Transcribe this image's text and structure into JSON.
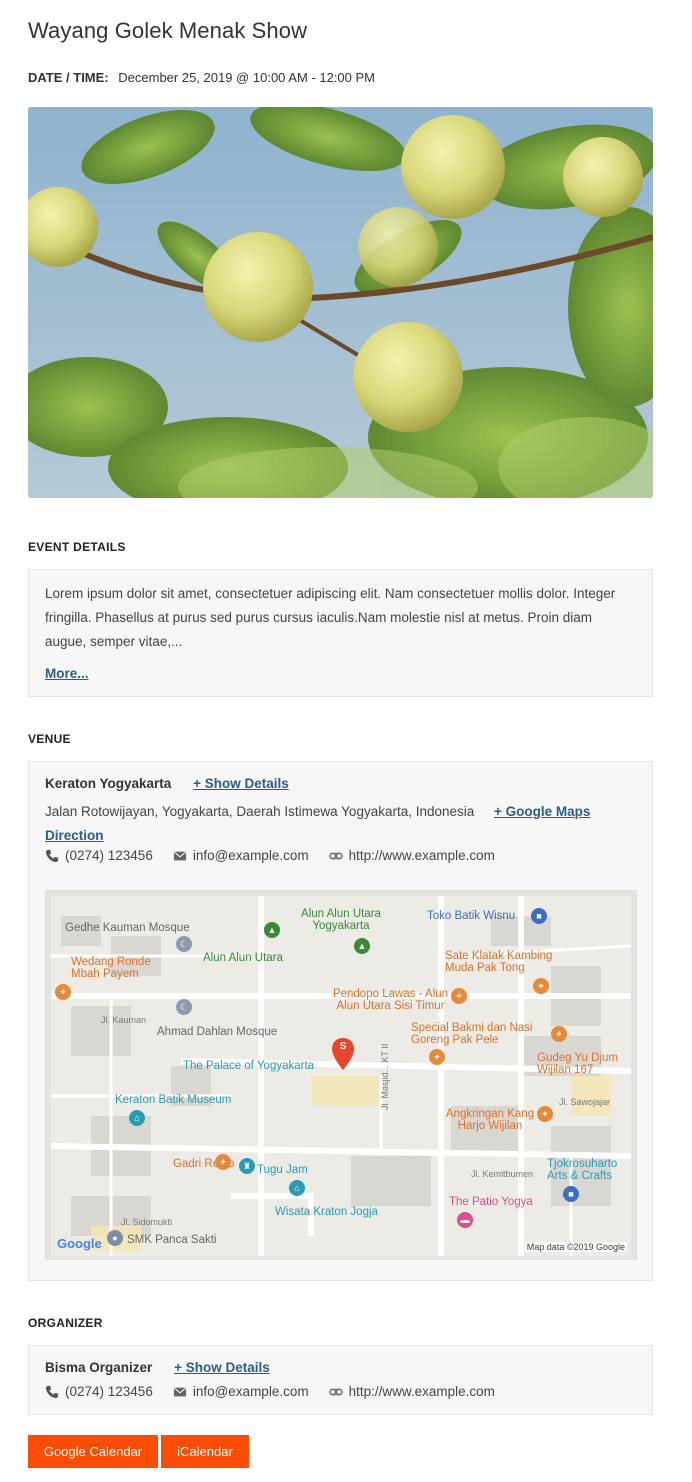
{
  "event": {
    "title": "Wayang Golek Menak Show",
    "datetime_label": "DATE / TIME:",
    "datetime_value": "December 25, 2019 @ 10:00 AM - 12:00 PM"
  },
  "details": {
    "heading": "EVENT DETAILS",
    "text": "Lorem ipsum dolor sit amet, consectetuer adipiscing elit. Nam consectetuer mollis dolor. Integer fringilla. Phasellus at purus sed purus cursus iaculis.Nam molestie nisl at metus. Proin diam augue, semper vitae,...",
    "more_link": "More..."
  },
  "venue": {
    "heading": "VENUE",
    "name": "Keraton Yogyakarta",
    "show_details": "+ Show Details",
    "address": "Jalan Rotowijayan, Yogyakarta, Daerah Istimewa Yogyakarta, Indonesia",
    "maps_link": "+ Google Maps Direction",
    "phone": "(0274) 123456",
    "email": "info@example.com",
    "website": "http://www.example.com"
  },
  "map": {
    "labels": {
      "gedhe": "Gedhe Kauman Mosque",
      "alun_utara_yogya": "Alun Alun Utara Yogyakarta",
      "toko_batik": "Toko Batik Wisnu",
      "alun_utara": "Alun Alun Utara",
      "sate": "Sate Klatak Kambing Muda Pak Tong",
      "wedang": "Wedang Ronde Mbah Payem",
      "pendopo": "Pendopo Lawas - Alun Alun Utara Sisi Timur",
      "kauman_street": "Jl. Kauman",
      "ahmad": "Ahmad Dahlan Mosque",
      "bakmi": "Special Bakmi dan Nasi Goreng Pak Pele",
      "gudeg": "Gudeg Yu Djum Wijilan 167",
      "palace": "The Palace of Yogyakarta",
      "keraton_batik": "Keraton Batik Museum",
      "sawojajar": "Jl. Sawojajar",
      "masjid_kt": "Jl. Masjid... KT II",
      "angkringan": "Angkringan Kang Harjo Wijilan",
      "gadri": "Gadri Resto",
      "tugu": "Tugu Jam",
      "kemitbumen": "Jl. Kemitbumen",
      "tjokro": "Tjokrosuharto Arts & Crafts",
      "patio": "The Patio Yogya",
      "wisata": "Wisata Kraton Jogja",
      "sidomukti": "Jl. Sidomukti",
      "smk": "SMK Panca Sakti"
    },
    "google_logo": "Google",
    "attribution": "Map data ©2019 Google",
    "marker_letter": "S"
  },
  "organizer": {
    "heading": "ORGANIZER",
    "name": "Bisma Organizer",
    "show_details": "+ Show Details",
    "phone": "(0274) 123456",
    "email": "info@example.com",
    "website": "http://www.example.com"
  },
  "buttons": {
    "google_calendar": "Google Calendar",
    "icalendar": "iCalendar"
  },
  "colors": {
    "accent": "#fb4d07",
    "link": "#2a5d8c"
  }
}
